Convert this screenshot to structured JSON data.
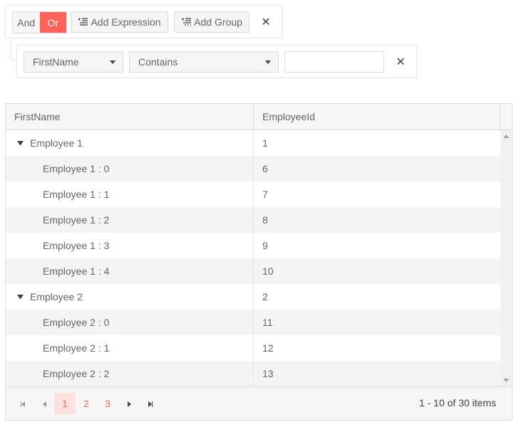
{
  "filter": {
    "logic": {
      "and_label": "And",
      "or_label": "Or",
      "selected": "Or"
    },
    "add_expression_label": "Add Expression",
    "add_group_label": "Add Group",
    "close_symbol": "✕",
    "expression": {
      "field": "FirstName",
      "operator": "Contains",
      "value": "",
      "close_symbol": "✕"
    }
  },
  "grid": {
    "columns": [
      "FirstName",
      "EmployeeId"
    ],
    "rows": [
      {
        "name": "Employee 1",
        "id": "1",
        "level": 0,
        "expandable": true
      },
      {
        "name": "Employee 1 : 0",
        "id": "6",
        "level": 1,
        "expandable": false
      },
      {
        "name": "Employee 1 : 1",
        "id": "7",
        "level": 1,
        "expandable": false
      },
      {
        "name": "Employee 1 : 2",
        "id": "8",
        "level": 1,
        "expandable": false
      },
      {
        "name": "Employee 1 : 3",
        "id": "9",
        "level": 1,
        "expandable": false
      },
      {
        "name": "Employee 1 : 4",
        "id": "10",
        "level": 1,
        "expandable": false
      },
      {
        "name": "Employee 2",
        "id": "2",
        "level": 0,
        "expandable": true
      },
      {
        "name": "Employee 2 : 0",
        "id": "11",
        "level": 1,
        "expandable": false
      },
      {
        "name": "Employee 2 : 1",
        "id": "12",
        "level": 1,
        "expandable": false
      },
      {
        "name": "Employee 2 : 2",
        "id": "13",
        "level": 1,
        "expandable": false
      }
    ]
  },
  "pager": {
    "pages": [
      "1",
      "2",
      "3"
    ],
    "current_page": "1",
    "info": "1 - 10 of 30 items"
  },
  "colors": {
    "accent": "#ff6358",
    "accent_light": "#ffe0dc"
  }
}
